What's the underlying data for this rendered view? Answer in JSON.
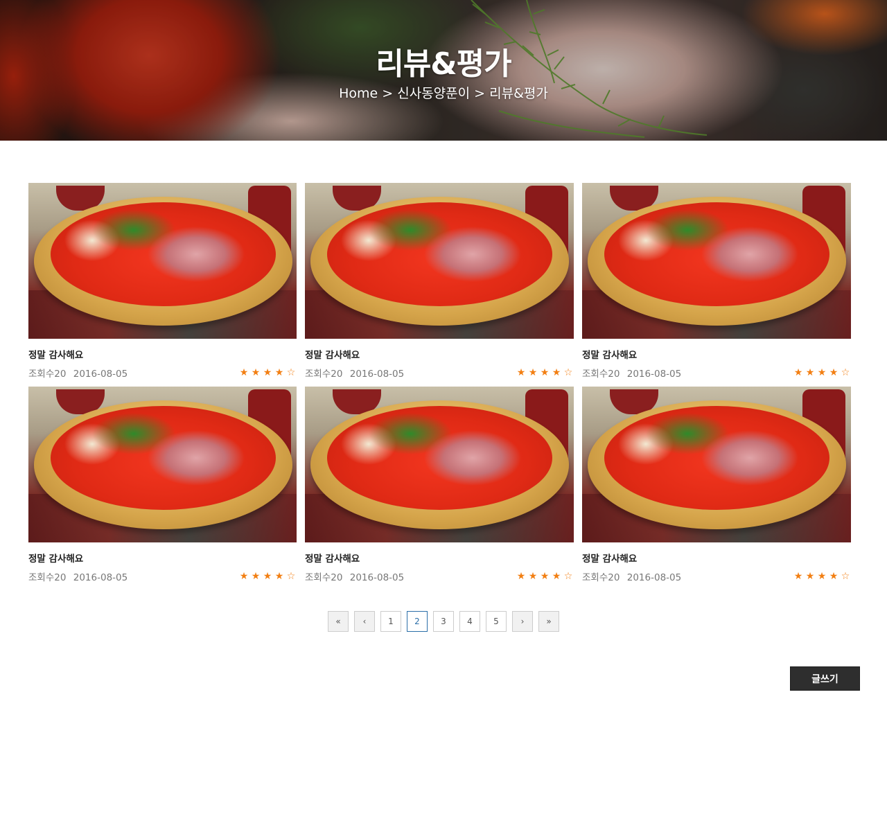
{
  "header": {
    "title": "리뷰&평가",
    "breadcrumb": {
      "home": "Home",
      "separator": ">",
      "section": "신사동양푼이",
      "current": "리뷰&평가"
    }
  },
  "reviews": [
    {
      "title": "정말 감사해요",
      "views": "조회수20",
      "date": "2016-08-05",
      "rating": 4,
      "max_rating": 5
    },
    {
      "title": "정말 감사해요",
      "views": "조회수20",
      "date": "2016-08-05",
      "rating": 4,
      "max_rating": 5
    },
    {
      "title": "정말 감사해요",
      "views": "조회수20",
      "date": "2016-08-05",
      "rating": 4,
      "max_rating": 5
    },
    {
      "title": "정말 감사해요",
      "views": "조회수20",
      "date": "2016-08-05",
      "rating": 4,
      "max_rating": 5
    },
    {
      "title": "정말 감사해요",
      "views": "조회수20",
      "date": "2016-08-05",
      "rating": 4,
      "max_rating": 5
    },
    {
      "title": "정말 감사해요",
      "views": "조회수20",
      "date": "2016-08-05",
      "rating": 4,
      "max_rating": 5
    }
  ],
  "pagination": {
    "first": "«",
    "prev": "‹",
    "pages": [
      "1",
      "2",
      "3",
      "4",
      "5"
    ],
    "current": "2",
    "next": "›",
    "last": "»"
  },
  "actions": {
    "write_label": "글쓰기"
  },
  "colors": {
    "star": "#f27f13",
    "active_page": "#2a6ea8",
    "write_button": "#2e2e2e"
  },
  "icons": {
    "star_filled": "star-filled-icon",
    "star_empty": "star-empty-icon"
  }
}
